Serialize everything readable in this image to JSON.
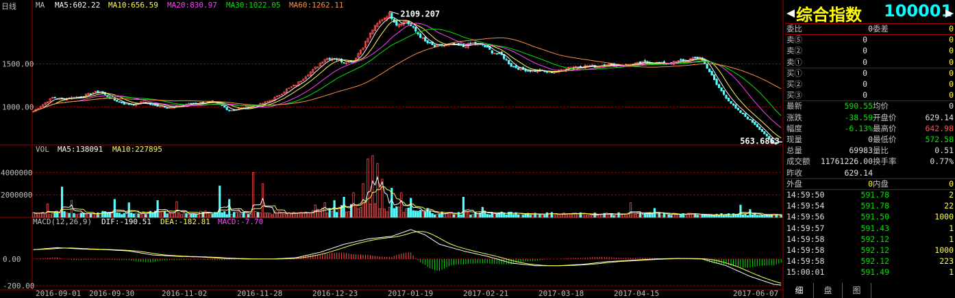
{
  "chart": {
    "period_label": "日线",
    "ma_label": "MA",
    "ma_values": [
      {
        "text": "MA5:602.22",
        "color": "#ffffff"
      },
      {
        "text": "MA10:656.59",
        "color": "#ffff54"
      },
      {
        "text": "MA20:830.97",
        "color": "#ff40ff"
      },
      {
        "text": "MA30:1022.05",
        "color": "#00e600"
      },
      {
        "text": "MA60:1262.11",
        "color": "#ff9040"
      }
    ],
    "vol_label": "VOL",
    "vol_values": [
      {
        "text": "MA5:138091",
        "color": "#ffffff"
      },
      {
        "text": "MA10:227895",
        "color": "#ffff54"
      }
    ],
    "macd_label": "MACD(12,26,9)",
    "macd_values": [
      {
        "text": "DIF:-190.51",
        "color": "#ffffff"
      },
      {
        "text": "DEA:-182.81",
        "color": "#ffff54"
      },
      {
        "text": "MACD:-7.70",
        "color": "#ff40ff"
      }
    ],
    "max_label": "2109.207",
    "min_label": "563.6863",
    "colors": {
      "up": "#ff5050",
      "down": "#54ffff",
      "grid": "#a00000",
      "axis": "#c0c0c0"
    }
  },
  "chart_data": {
    "type": "candlestick",
    "price_axis": {
      "ticks": [
        "1500.00",
        "1000.00"
      ],
      "values": [
        1500,
        1000
      ]
    },
    "volume_axis": {
      "ticks": [
        "4000000",
        "2000000"
      ],
      "values": [
        4000000,
        2000000
      ]
    },
    "macd_axis": {
      "ticks": [
        "0.00",
        "-200.00"
      ],
      "values": [
        0,
        -200
      ]
    },
    "x_dates": [
      "2016-09-01",
      "2016-09-30",
      "2016-11-02",
      "2016-11-28",
      "2016-12-23",
      "2017-01-19",
      "2017-02-21",
      "2017-03-18",
      "2017-04-15",
      "2017-06-07"
    ],
    "price_path": [
      [
        0,
        950
      ],
      [
        4,
        1030
      ],
      [
        8,
        1110
      ],
      [
        12,
        1090
      ],
      [
        16,
        1110
      ],
      [
        20,
        1120
      ],
      [
        24,
        1160
      ],
      [
        28,
        1180
      ],
      [
        30,
        1140
      ],
      [
        34,
        1080
      ],
      [
        38,
        1040
      ],
      [
        42,
        1030
      ],
      [
        46,
        1060
      ],
      [
        50,
        1020
      ],
      [
        54,
        1010
      ],
      [
        58,
        990
      ],
      [
        62,
        1020
      ],
      [
        66,
        1040
      ],
      [
        70,
        1050
      ],
      [
        74,
        1060
      ],
      [
        78,
        1030
      ],
      [
        82,
        960
      ],
      [
        86,
        980
      ],
      [
        90,
        1000
      ],
      [
        94,
        1020
      ],
      [
        98,
        1060
      ],
      [
        102,
        1120
      ],
      [
        106,
        1200
      ],
      [
        110,
        1260
      ],
      [
        114,
        1360
      ],
      [
        118,
        1450
      ],
      [
        122,
        1560
      ],
      [
        126,
        1570
      ],
      [
        130,
        1520
      ],
      [
        134,
        1540
      ],
      [
        138,
        1700
      ],
      [
        142,
        1900
      ],
      [
        146,
        2020
      ],
      [
        149,
        2080
      ],
      [
        152,
        1960
      ],
      [
        156,
        2000
      ],
      [
        160,
        1880
      ],
      [
        164,
        1760
      ],
      [
        168,
        1700
      ],
      [
        172,
        1720
      ],
      [
        176,
        1720
      ],
      [
        180,
        1700
      ],
      [
        184,
        1740
      ],
      [
        188,
        1720
      ],
      [
        192,
        1640
      ],
      [
        196,
        1600
      ],
      [
        200,
        1480
      ],
      [
        204,
        1440
      ],
      [
        208,
        1420
      ],
      [
        212,
        1420
      ],
      [
        216,
        1400
      ],
      [
        220,
        1420
      ],
      [
        224,
        1460
      ],
      [
        228,
        1470
      ],
      [
        232,
        1480
      ],
      [
        236,
        1470
      ],
      [
        240,
        1500
      ],
      [
        244,
        1480
      ],
      [
        248,
        1490
      ],
      [
        252,
        1500
      ],
      [
        256,
        1520
      ],
      [
        260,
        1510
      ],
      [
        264,
        1500
      ],
      [
        268,
        1520
      ],
      [
        272,
        1540
      ],
      [
        276,
        1560
      ],
      [
        279,
        1580
      ],
      [
        282,
        1460
      ],
      [
        286,
        1260
      ],
      [
        290,
        1110
      ],
      [
        294,
        980
      ],
      [
        298,
        890
      ],
      [
        302,
        800
      ],
      [
        306,
        690
      ],
      [
        309,
        590
      ],
      [
        313,
        600
      ]
    ],
    "volume_spikes": [
      [
        6,
        1200000
      ],
      [
        12,
        2700000
      ],
      [
        16,
        1500000
      ],
      [
        34,
        1600000
      ],
      [
        40,
        1300000
      ],
      [
        52,
        1500000
      ],
      [
        60,
        1400000
      ],
      [
        78,
        2800000
      ],
      [
        82,
        1600000
      ],
      [
        92,
        4000000
      ],
      [
        96,
        3000000
      ],
      [
        118,
        1100000
      ],
      [
        122,
        1300000
      ],
      [
        126,
        1500000
      ],
      [
        130,
        1800000
      ],
      [
        134,
        2200000
      ],
      [
        138,
        3000000
      ],
      [
        140,
        5200000
      ],
      [
        142,
        5500000
      ],
      [
        144,
        4800000
      ],
      [
        146,
        3400000
      ],
      [
        150,
        2600000
      ],
      [
        154,
        2200000
      ],
      [
        158,
        1700000
      ],
      [
        165,
        800000
      ],
      [
        180,
        1800000
      ],
      [
        188,
        900000
      ],
      [
        250,
        1300000
      ],
      [
        260,
        800000
      ],
      [
        296,
        1100000
      ],
      [
        300,
        700000
      ]
    ],
    "macd_path": [
      [
        0,
        70
      ],
      [
        10,
        85
      ],
      [
        20,
        75
      ],
      [
        30,
        70
      ],
      [
        40,
        60
      ],
      [
        50,
        30
      ],
      [
        60,
        20
      ],
      [
        70,
        15
      ],
      [
        80,
        5
      ],
      [
        90,
        0
      ],
      [
        100,
        0
      ],
      [
        110,
        10
      ],
      [
        120,
        50
      ],
      [
        130,
        110
      ],
      [
        140,
        150
      ],
      [
        150,
        170
      ],
      [
        158,
        220
      ],
      [
        164,
        180
      ],
      [
        170,
        110
      ],
      [
        180,
        60
      ],
      [
        190,
        20
      ],
      [
        200,
        -30
      ],
      [
        210,
        -50
      ],
      [
        220,
        -50
      ],
      [
        230,
        -40
      ],
      [
        240,
        -20
      ],
      [
        250,
        -10
      ],
      [
        260,
        0
      ],
      [
        270,
        5
      ],
      [
        280,
        0
      ],
      [
        290,
        -50
      ],
      [
        300,
        -130
      ],
      [
        310,
        -190
      ],
      [
        313,
        -195
      ]
    ]
  },
  "quote": {
    "name": "综合指数",
    "code": "100001",
    "rows_top": [
      {
        "l": "委比",
        "v": "0",
        "l2": "委差",
        "v2": "0"
      }
    ],
    "sell": [
      {
        "l": "卖⑤",
        "p": "0",
        "q": "0"
      },
      {
        "l": "卖②",
        "p": "0",
        "q": "0"
      },
      {
        "l": "卖①",
        "p": "0",
        "q": "0"
      }
    ],
    "buy": [
      {
        "l": "买①",
        "p": "0",
        "q": "0"
      },
      {
        "l": "买②",
        "p": "0",
        "q": "0"
      },
      {
        "l": "买③",
        "p": "0",
        "q": "0"
      }
    ],
    "stats": [
      {
        "l": "最新",
        "v": "590.55",
        "vc": "c-green",
        "l2": "均价",
        "v2": "0",
        "v2c": "c-white"
      },
      {
        "l": "涨跌",
        "v": "-38.59",
        "vc": "c-green",
        "l2": "开盘价",
        "v2": "629.14",
        "v2c": "c-white"
      },
      {
        "l": "幅度",
        "v": "-6.13%",
        "vc": "c-green",
        "l2": "最高价",
        "v2": "642.98",
        "v2c": "c-red"
      },
      {
        "l": "现量",
        "v": "0",
        "vc": "c-white",
        "l2": "最低价",
        "v2": "572.58",
        "v2c": "c-green"
      },
      {
        "l": "总量",
        "v": "69983",
        "vc": "c-white",
        "l2": "量比",
        "v2": "0.51",
        "v2c": "c-white"
      },
      {
        "l": "成交额",
        "v": "11761226.00",
        "vc": "c-white",
        "l2": "换手率",
        "v2": "0.77%",
        "v2c": "c-white"
      },
      {
        "l": "昨收",
        "v": "629.14",
        "vc": "c-white",
        "l2": "",
        "v2": "",
        "v2c": "c-white"
      }
    ],
    "outer_label": "外盘",
    "outer_value": "0",
    "inner_label": "内盘",
    "inner_value": "0",
    "ticks": [
      {
        "t": "14:59:50",
        "p": "591.78",
        "q": "2"
      },
      {
        "t": "14:59:54",
        "p": "591.78",
        "q": "22"
      },
      {
        "t": "14:59:56",
        "p": "591.50",
        "q": "1000"
      },
      {
        "t": "14:59:57",
        "p": "591.43",
        "q": "1"
      },
      {
        "t": "14:59:58",
        "p": "592.12",
        "q": "1"
      },
      {
        "t": "14:59:58",
        "p": "592.12",
        "q": "1000"
      },
      {
        "t": "14:59:58",
        "p": "592.12",
        "q": "223"
      },
      {
        "t": "15:00:01",
        "p": "591.49",
        "q": "1"
      }
    ],
    "tabs": [
      "细",
      "盘",
      "图"
    ]
  }
}
